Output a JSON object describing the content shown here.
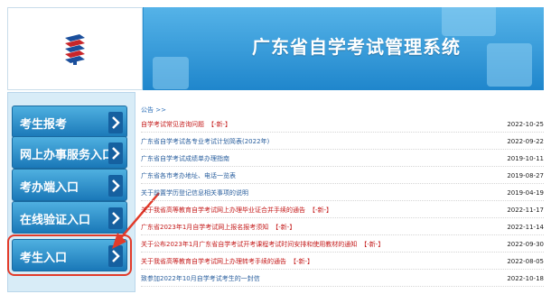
{
  "header": {
    "title": "广东省自学考试管理系统",
    "logo_icon": "exam-logo-icon"
  },
  "sidebar": {
    "items": [
      {
        "label": "考生报考"
      },
      {
        "label": "网上办事服务入口"
      },
      {
        "label": "考办端入口"
      },
      {
        "label": "在线验证入口"
      },
      {
        "label": "考生入口"
      }
    ],
    "arrow_icon": "chevron-right-icon"
  },
  "notices": {
    "title": "公告 >>",
    "new_tag": "【-新-】",
    "items": [
      {
        "text": "自学考试常见咨询问题",
        "new": true,
        "date": "2022-10-25",
        "color": "#c41a1a"
      },
      {
        "text": "广东省自学考试各专业考试计划简表(2022年)",
        "new": false,
        "date": "2022-09-22",
        "color": "#2a5f9e"
      },
      {
        "text": "广东省自学考试成绩单办理指南",
        "new": false,
        "date": "2019-10-11",
        "color": "#2a5f9e"
      },
      {
        "text": "广东省各市考办地址、电话一览表",
        "new": false,
        "date": "2019-08-27",
        "color": "#2a5f9e"
      },
      {
        "text": "关于前置学历登记信息相关事项的说明",
        "new": false,
        "date": "2019-04-19",
        "color": "#2a5f9e"
      },
      {
        "text": "关于我省高等教育自学考试网上办理毕业证合并手续的通告",
        "new": true,
        "date": "2022-11-17",
        "color": "#c41a1a"
      },
      {
        "text": "广东省2023年1月自学考试网上报名报考须知",
        "new": true,
        "date": "2022-11-14",
        "color": "#c41a1a"
      },
      {
        "text": "关于公布2023年1月广东省自学考试开考课程考试时间安排和使用教材的通知",
        "new": true,
        "date": "2022-09-30",
        "color": "#c41a1a"
      },
      {
        "text": "关于我省高等教育自学考试网上办理转考手续的通告",
        "new": true,
        "date": "2022-08-05",
        "color": "#c41a1a"
      },
      {
        "text": "致参加2022年10月自学考试考生的一封信",
        "new": false,
        "date": "2022-10-18",
        "color": "#2a5f9e"
      }
    ]
  },
  "colors": {
    "accent": "#2a8fd0",
    "annotation": "#e23b2a"
  }
}
